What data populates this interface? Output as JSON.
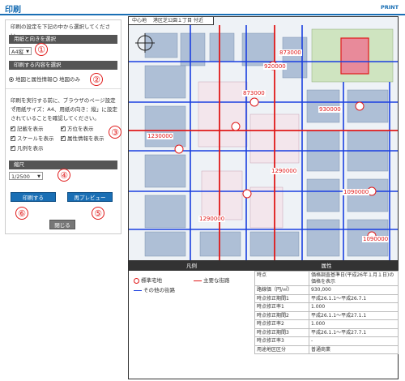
{
  "header": {
    "title": "印刷",
    "print_link": "PRINT"
  },
  "left": {
    "intro": "印刷の設定を下記の中から選択してください。",
    "paper_section": "用紙と向きを選択",
    "paper_value": "A4縦",
    "content_section": "印刷する内容を選択",
    "radio_map_attr": "地図と属性情報",
    "radio_map_only": "地図のみ",
    "note_lines": [
      "印刷を実行する前に、ブラウザのページ設定で",
      "「用紙サイズ：A4、用紙の向き：縦」に設定",
      "されていることを確認してください。"
    ],
    "checks": [
      "記載を表示",
      "方位を表示",
      "スケールを表示",
      "属性情報を表示",
      "凡例を表示"
    ],
    "scale_section": "縮尺",
    "scale_value": "1/2500",
    "print_button": "印刷する",
    "preview_button": "再プレビュー",
    "close_button": "閉じる",
    "markers": [
      "①",
      "②",
      "③",
      "④",
      "⑤",
      "⑥"
    ]
  },
  "map": {
    "header_center": "中心地",
    "header_place": "港区芝公園１丁目 付近",
    "price_labels": [
      "873000",
      "920000",
      "873000",
      "1230000",
      "1290000",
      "1090000",
      "1090000",
      "930000",
      "1290000"
    ],
    "colors": {
      "road_red": "#e01a1a",
      "road_blue": "#1a3fe0",
      "building": "#aebfd6",
      "block": "#f3e6ec",
      "park": "#cfe4c0"
    }
  },
  "legend": {
    "legend_title": "凡例",
    "attr_title": "属性",
    "items": [
      "標準宅地",
      "主要な街路",
      "その他の街路"
    ],
    "rows": [
      {
        "k": "時点",
        "v": "価格調査基準日(平成26年１月１日)の価格を表示"
      },
      {
        "k": "路線価（円/㎡）",
        "v": "930,000"
      },
      {
        "k": "時点修正期間1",
        "v": "平成26.1.1〜平成26.7.1"
      },
      {
        "k": "時点修正率1",
        "v": "1.000"
      },
      {
        "k": "時点修正期間2",
        "v": "平成26.1.1〜平成27.1.1"
      },
      {
        "k": "時点修正率2",
        "v": "1.000"
      },
      {
        "k": "時点修正期間3",
        "v": "平成26.1.1〜平成27.7.1"
      },
      {
        "k": "時点修正率3",
        "v": "-"
      },
      {
        "k": "用途地区区分",
        "v": "普通商業"
      }
    ]
  }
}
